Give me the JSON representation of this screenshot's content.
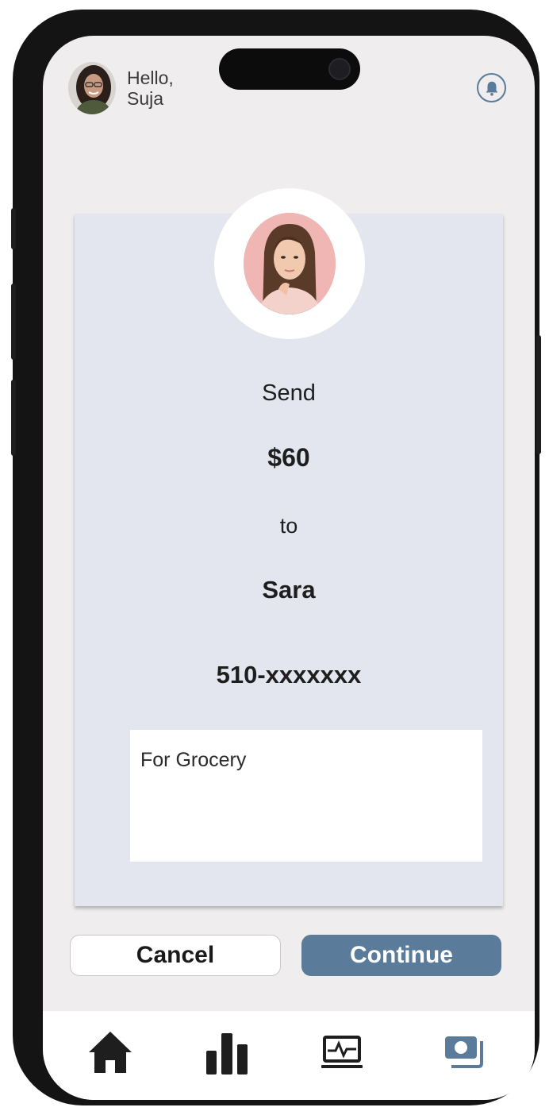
{
  "header": {
    "greeting_line1": "Hello,",
    "greeting_line2": "Suja",
    "avatar_icon": "user-avatar",
    "notification_icon": "bell-icon"
  },
  "transfer": {
    "recipient_photo_icon": "recipient-avatar",
    "send_label": "Send",
    "amount": "$60",
    "to_label": "to",
    "recipient_name": "Sara",
    "recipient_phone": "510-xxxxxxx",
    "note": "For Grocery"
  },
  "actions": {
    "cancel_label": "Cancel",
    "continue_label": "Continue"
  },
  "nav": {
    "items": [
      {
        "icon": "home-icon",
        "active": false
      },
      {
        "icon": "bar-chart-icon",
        "active": false
      },
      {
        "icon": "activity-monitor-icon",
        "active": false
      },
      {
        "icon": "money-transfer-icon",
        "active": true
      }
    ]
  },
  "colors": {
    "accent": "#5a7b9a",
    "card_background": "#e3e6ee",
    "screen_background": "#efeded",
    "nav_icon": "#1e1e1e"
  }
}
